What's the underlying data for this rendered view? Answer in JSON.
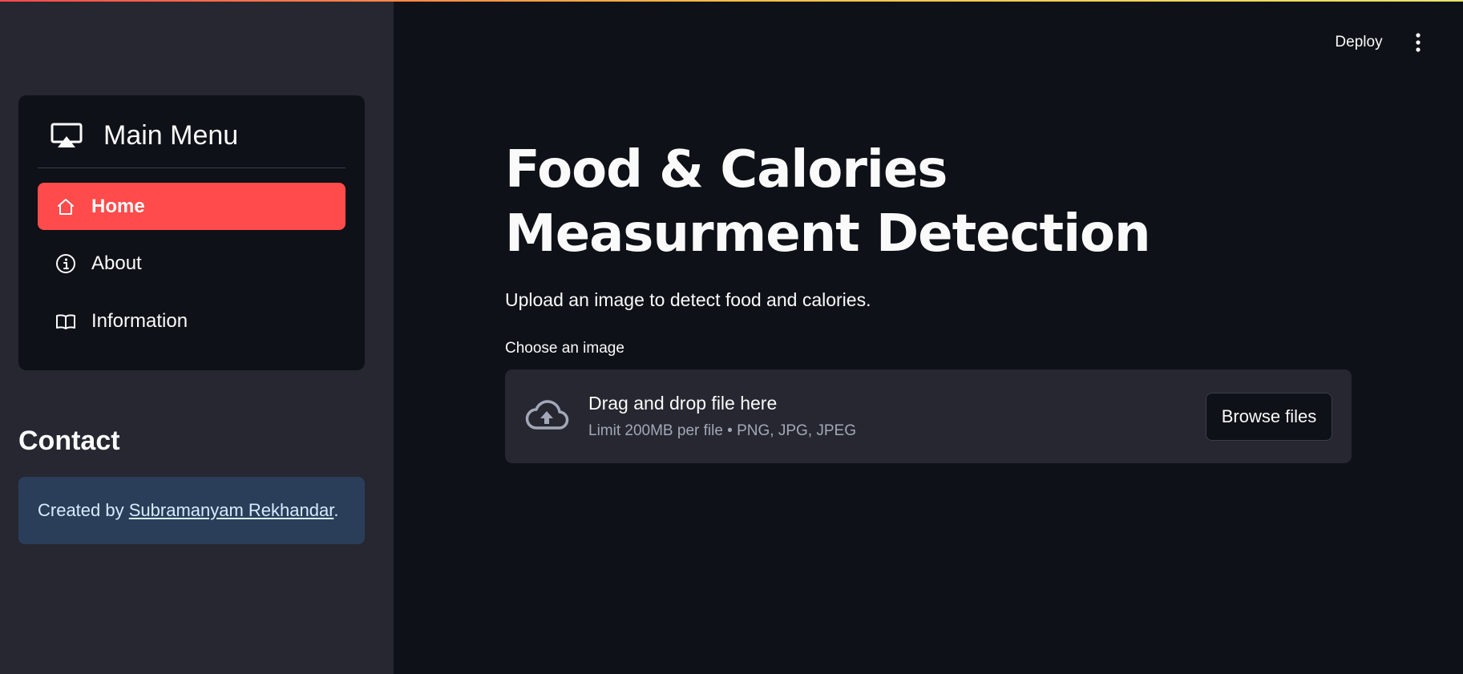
{
  "sidebar": {
    "menu": {
      "title": "Main Menu",
      "items": [
        {
          "label": "Home",
          "icon": "house-icon",
          "active": true
        },
        {
          "label": "About",
          "icon": "info-circle-icon",
          "active": false
        },
        {
          "label": "Information",
          "icon": "book-icon",
          "active": false
        }
      ]
    },
    "contact": {
      "heading": "Contact",
      "prefix": "Created by ",
      "link_text": "Subramanyam Rekhandar",
      "suffix": "."
    }
  },
  "header": {
    "deploy_label": "Deploy",
    "more_icon": "vertical-ellipsis-icon"
  },
  "main": {
    "title": "Food & Calories Measurment Detection",
    "subtitle": "Upload an image to detect food and calories.",
    "uploader": {
      "label": "Choose an image",
      "drag_text": "Drag and drop file here",
      "limit_text": "Limit 200MB per file • PNG, JPG, JPEG",
      "browse_label": "Browse files",
      "icon": "cloud-upload-icon"
    }
  },
  "colors": {
    "accent": "#ff4b4b",
    "sidebar_bg": "#262730",
    "main_bg": "#0e1117",
    "contact_bg": "#2b3e59"
  }
}
